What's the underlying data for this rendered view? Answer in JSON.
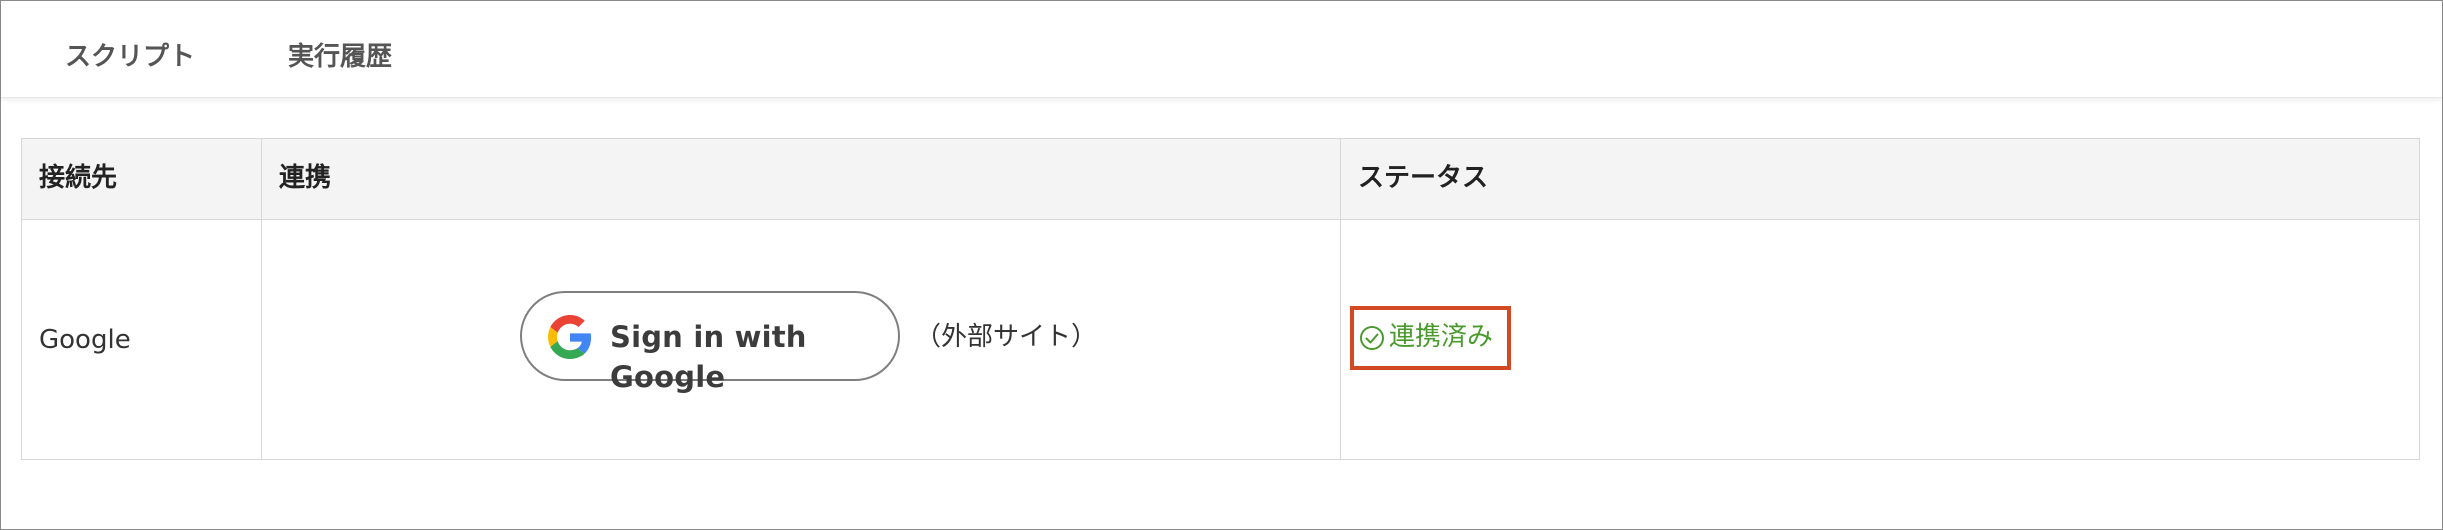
{
  "tabs": [
    {
      "label": "スクリプト"
    },
    {
      "label": "実行履歴"
    }
  ],
  "table": {
    "headers": [
      "接続先",
      "連携",
      "ステータス"
    ],
    "rows": [
      {
        "provider": "Google",
        "signin_button": "Sign in with Google",
        "external_note": "（外部サイト）",
        "status": "連携済み"
      }
    ]
  },
  "icons": {
    "signin": "google-g-icon",
    "status": "check-circle-icon"
  },
  "colors": {
    "status_text": "#4a9a2e",
    "highlight_border": "#d14a24"
  }
}
